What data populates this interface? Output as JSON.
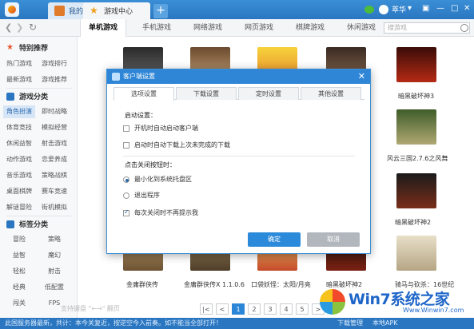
{
  "titlebar": {
    "tabs": [
      {
        "label": "我的游戏"
      },
      {
        "label": "游戏中心"
      }
    ],
    "user": "萃华"
  },
  "nav": {
    "categories": [
      "单机游戏",
      "手机游戏",
      "网络游戏",
      "网页游戏",
      "棋牌游戏",
      "休闲游戏"
    ],
    "search_placeholder": "搜游戏"
  },
  "sidebar": {
    "sections": [
      {
        "title": "特别推荐",
        "items": [
          "热门游戏",
          "游戏排行",
          "最新游戏",
          "游戏推荐"
        ]
      },
      {
        "title": "游戏分类",
        "items": [
          "角色扮演",
          "即时战略",
          "体育竞技",
          "模拟经营",
          "休闲益智",
          "射击游戏",
          "动作游戏",
          "恋爱养成",
          "音乐游戏",
          "策略战棋",
          "桌面棋牌",
          "赛车竞速",
          "解谜冒险",
          "街机模拟"
        ]
      },
      {
        "title": "标签分类",
        "items": [
          "冒险",
          "策略",
          "益智",
          "魔幻",
          "轻松",
          "射击",
          "经典",
          "低配置",
          "闯关",
          "FPS"
        ]
      }
    ]
  },
  "content": {
    "captions": [
      "暗黑破坏神3",
      "风云三国2.7.6之风舞",
      "暗黑破坏神2",
      "金庸群侠传",
      "金庸群侠传X 1.1.0.6",
      "口袋妖怪：太阳/月亮",
      "暗黑破坏神2",
      "骑马与砍杀：16世纪"
    ]
  },
  "pager": {
    "hint": "支持键盘 \"←→\" 翻页",
    "pages": [
      "1",
      "2",
      "3",
      "4",
      "5"
    ]
  },
  "statusbar": {
    "text": "此国服务器最新，共计：本今关复近，按逆空今入前奏。如不能当全部打开！",
    "download": "下载管理",
    "apk": "本地APK"
  },
  "watermark": {
    "title": "Win7系统之家",
    "url": "Www.Winwin7.com"
  },
  "dialog": {
    "title": "客户端设置",
    "tabs": [
      "选项设置",
      "下载设置",
      "定时设置",
      "其他设置"
    ],
    "startup_label": "启动设置：",
    "startup_opts": [
      "开机时自动启动客户端",
      "启动时自动下载上次未完成的下载"
    ],
    "close_label": "点击关闭按钮时：",
    "close_opts": [
      "最小化到系统托盘区",
      "退出程序"
    ],
    "no_prompt": "每次关闭时不再提示我",
    "ok": "确定",
    "cancel": "取消"
  }
}
